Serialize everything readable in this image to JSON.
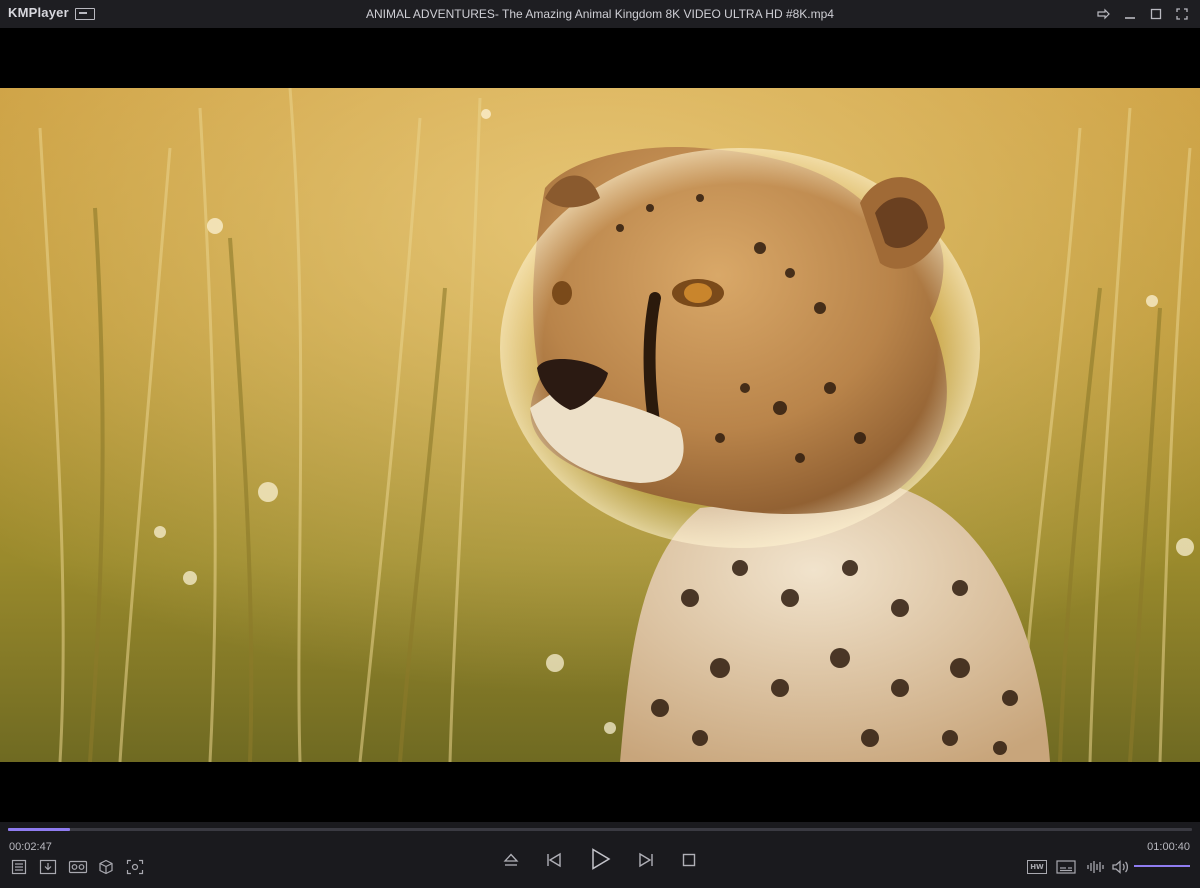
{
  "app": {
    "logo": "KMPlayer",
    "title": "ANIMAL ADVENTURES- The Amazing Animal Kingdom 8K VIDEO ULTRA HD #8K.mp4"
  },
  "window_controls": [
    "pin-icon",
    "minimize-icon",
    "maximize-icon",
    "fullscreen-icon"
  ],
  "video": {
    "subject": "cheetah cub in golden grass"
  },
  "playback": {
    "current_time": "00:02:47",
    "total_time": "01:00:40",
    "progress": 0.052,
    "volume": 1.0,
    "accent_color": "#8f7cf0"
  },
  "left_tools": [
    "playlist-icon",
    "download-icon",
    "vr-icon",
    "3d-cube-icon",
    "capture-icon"
  ],
  "center_controls": [
    "eject-icon",
    "previous-icon",
    "play-icon",
    "next-icon",
    "stop-icon"
  ],
  "right_tools": {
    "hw_label": "HW",
    "items": [
      "hw-decoder-icon",
      "subtitle-icon",
      "equalizer-icon",
      "volume-icon"
    ]
  }
}
